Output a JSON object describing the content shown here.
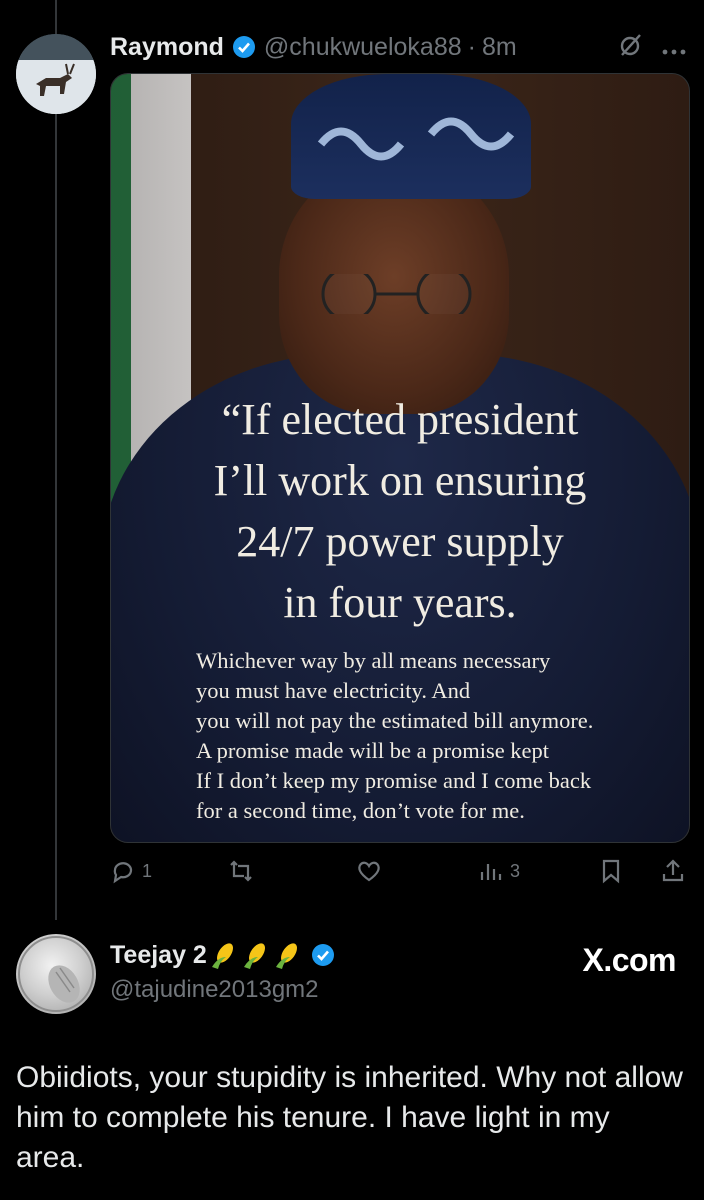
{
  "tweet": {
    "author_name": "Raymond",
    "author_handle": "@chukwueloka88",
    "separator": "·",
    "time": "8m",
    "image_quote": {
      "headline_lines": [
        "“If elected president",
        "I’ll work on ensuring",
        "24/7 power supply",
        "in four years."
      ],
      "body_lines": [
        "Whichever way by all means necessary",
        "you must have electricity. And",
        "you will not pay the estimated bill anymore.",
        "A promise made will be a promise kept",
        "If I don’t keep my promise and I come back",
        "for a second time, don’t vote for me."
      ]
    },
    "actions": {
      "replies": "1",
      "views": "3"
    }
  },
  "reply": {
    "author_name": "Teejay 2",
    "author_handle": "@tajudine2013gm2",
    "brand": "X.com",
    "text": "Obiidiots, your stupidity is inherited. Why not allow him to complete his tenure. I have light in my area."
  },
  "colors": {
    "background": "#000000",
    "text": "#e7e9ea",
    "muted": "#71767b",
    "verified": "#1d9bf0"
  },
  "icons": [
    "verified-badge-icon",
    "grok-icon",
    "more-icon",
    "reply-icon",
    "retweet-icon",
    "like-icon",
    "views-icon",
    "bookmark-icon",
    "share-icon",
    "corn-emoji-icon"
  ]
}
